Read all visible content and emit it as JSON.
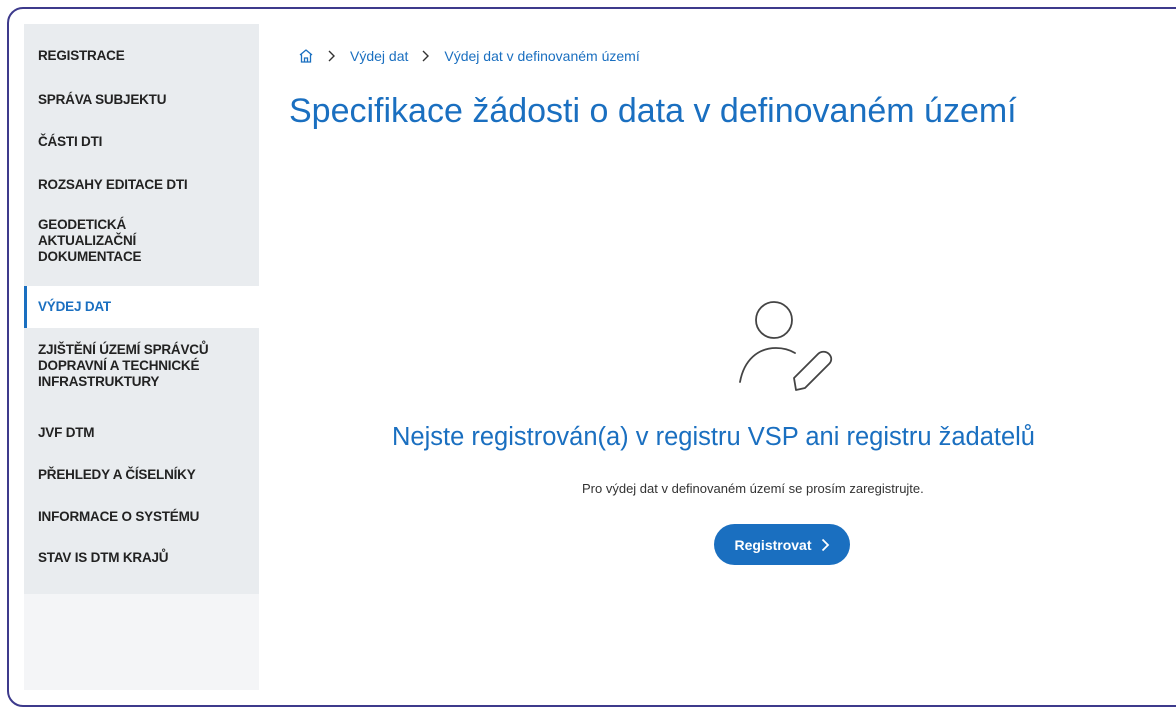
{
  "sidebar": {
    "items": [
      {
        "label": "REGISTRACE",
        "lines": [
          "REGISTRACE"
        ],
        "active": false
      },
      {
        "label": "SPRÁVA SUBJEKTU",
        "lines": [
          "SPRÁVA SUBJEKTU"
        ],
        "active": false
      },
      {
        "label": "ČÁSTI DTI",
        "lines": [
          "ČÁSTI DTI"
        ],
        "active": false
      },
      {
        "label": "ROZSAHY EDITACE DTI",
        "lines": [
          "ROZSAHY EDITACE DTI"
        ],
        "active": false
      },
      {
        "label": "GEODETICKÁ AKTUALIZAČNÍ DOKUMENTACE",
        "lines": [
          "GEODETICKÁ",
          "AKTUALIZAČNÍ",
          "DOKUMENTACE"
        ],
        "active": false
      },
      {
        "label": "VÝDEJ DAT",
        "lines": [
          "VÝDEJ DAT"
        ],
        "active": true
      },
      {
        "label": "ZJIŠTĚNÍ ÚZEMÍ SPRÁVCŮ DOPRAVNÍ A TECHNICKÉ INFRASTRUKTURY",
        "lines": [
          "ZJIŠTĚNÍ ÚZEMÍ SPRÁVCŮ",
          "DOPRAVNÍ A TECHNICKÉ",
          "INFRASTRUKTURY"
        ],
        "active": false
      },
      {
        "label": "JVF DTM",
        "lines": [
          "JVF DTM"
        ],
        "active": false
      },
      {
        "label": "PŘEHLEDY A ČÍSELNÍKY",
        "lines": [
          "PŘEHLEDY A ČÍSELNÍKY"
        ],
        "active": false
      },
      {
        "label": "INFORMACE O SYSTÉMU",
        "lines": [
          "INFORMACE O SYSTÉMU"
        ],
        "active": false
      },
      {
        "label": "STAV IS DTM KRAJŮ",
        "lines": [
          "STAV IS DTM KRAJŮ"
        ],
        "active": false
      }
    ]
  },
  "breadcrumb": {
    "home_icon": "home-icon",
    "items": [
      "Výdej dat",
      "Výdej dat v definovaném území"
    ]
  },
  "main": {
    "title": "Specifikace žádosti o data v definovaném území",
    "empty_state": {
      "icon": "user-edit-icon",
      "heading": "Nejste registrován(a) v registru VSP ani registru žadatelů",
      "text": "Pro výdej dat v definovaném území se prosím zaregistrujte.",
      "button_label": "Registrovat"
    }
  },
  "colors": {
    "accent": "#1a6fc0",
    "sidebar_bg": "#e9ecef",
    "frame_border": "#3d3a8c"
  }
}
